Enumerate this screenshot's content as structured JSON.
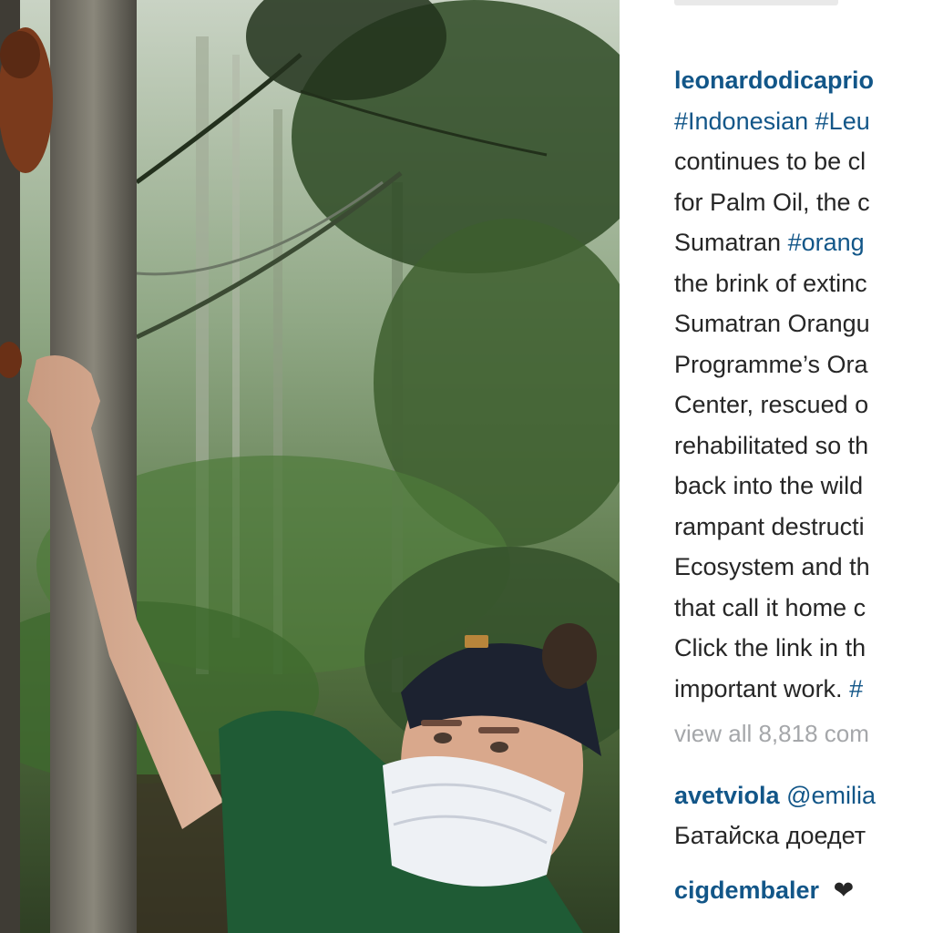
{
  "post": {
    "author": "leonardodicaprio",
    "caption_lines": [
      [
        "#Indonesian",
        " ",
        "#Leu"
      ],
      "continues to be cl",
      "for Palm Oil, the c",
      [
        "Sumatran ",
        "#orang"
      ],
      "the brink of extinc",
      "Sumatran Orangu",
      "Programme’s Ora",
      "Center, rescued o",
      "rehabilitated so th",
      "back into the wild",
      "rampant destructi",
      "Ecosystem and th",
      "that call it home c",
      "Click the link in th",
      [
        "important work. ",
        "#"
      ]
    ],
    "view_all_comments": "view all 8,818 com"
  },
  "comments": [
    {
      "user": "avetviola",
      "mention": "@emilia",
      "text": "Батайска доедет"
    },
    {
      "user": "cigdembaler",
      "text": "",
      "heart_icon": "heart-icon"
    }
  ],
  "colors": {
    "link": "#125688",
    "text": "#262626",
    "muted": "#a5a7aa"
  }
}
